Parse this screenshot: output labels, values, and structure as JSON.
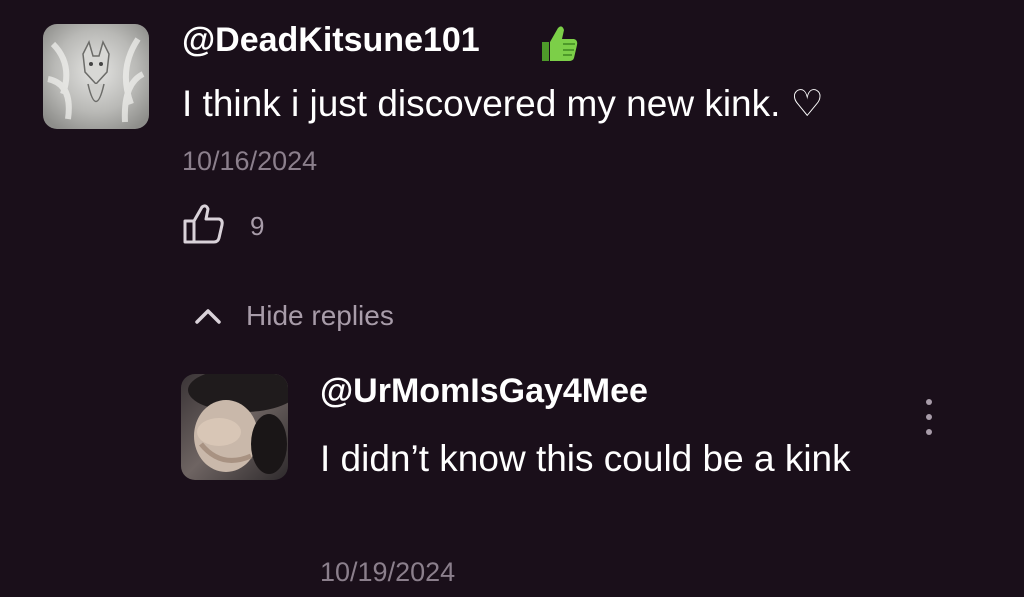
{
  "comment": {
    "username": "@DeadKitsune101",
    "text": "I think i just discovered my new kink. ♡",
    "date": "10/16/2024",
    "likes": "9",
    "badge_icon": "thumbs-up-icon",
    "badge_color": "#6abf3a"
  },
  "replies_toggle": {
    "label": "Hide replies",
    "icon": "chevron-up-icon"
  },
  "reply": {
    "username": "@UrMomIsGay4Mee",
    "text": "I didn’t know this could be a kink",
    "date": "10/19/2024",
    "menu_icon": "more-vertical-icon"
  },
  "colors": {
    "background": "#1a0f1a",
    "text_primary": "#ffffff",
    "text_secondary": "#8b7f8c"
  }
}
